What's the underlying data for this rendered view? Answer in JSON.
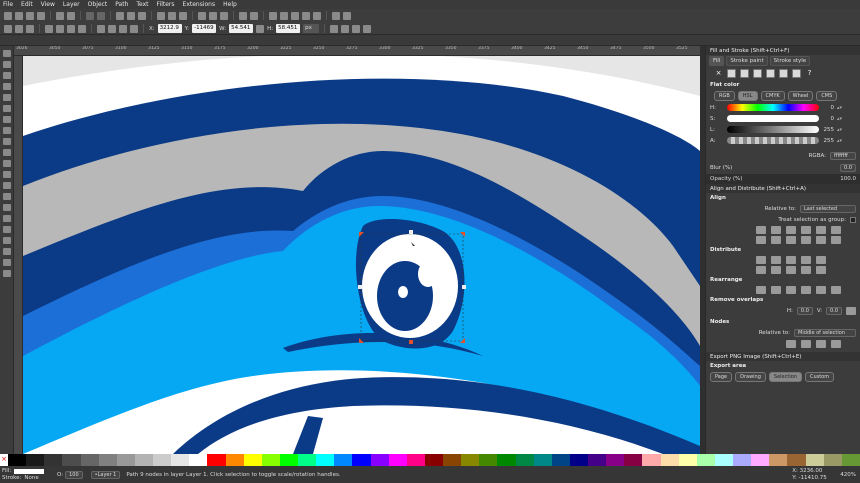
{
  "menu": [
    "File",
    "Edit",
    "View",
    "Layer",
    "Object",
    "Path",
    "Text",
    "Filters",
    "Extensions",
    "Help"
  ],
  "coords": {
    "x_label": "X:",
    "x_value": "3212.9",
    "y_label": "Y:",
    "y_value": "-11469",
    "w_label": "W:",
    "w_value": "54.541",
    "h_label": "H:",
    "h_value": "58.451",
    "unit": "px"
  },
  "ruler_labels": [
    "3026",
    "3050",
    "3075",
    "3100",
    "3125",
    "3150",
    "3175",
    "3200",
    "3225",
    "3250",
    "3275",
    "3300",
    "3325",
    "3350",
    "3375",
    "3400",
    "3425",
    "3450",
    "3475",
    "3500",
    "3525"
  ],
  "panel": {
    "fill_stroke_title": "Fill and Stroke (Shift+Ctrl+F)",
    "tabs": [
      "Fill",
      "Stroke paint",
      "Stroke style"
    ],
    "flat_color": "Flat color",
    "modes": [
      "RGB",
      "HSL",
      "CMYK",
      "Wheel",
      "CMS"
    ],
    "sliders": [
      {
        "label": "H:",
        "value": "0"
      },
      {
        "label": "S:",
        "value": "0"
      },
      {
        "label": "L:",
        "value": "255"
      },
      {
        "label": "A:",
        "value": "255"
      }
    ],
    "rgba_label": "RGBA:",
    "rgba_value": "ffffffff",
    "blur_label": "Blur (%)",
    "blur_value": "0.0",
    "opacity_label": "Opacity (%)",
    "opacity_value": "100.0",
    "align_title": "Align and Distribute (Shift+Ctrl+A)",
    "align": "Align",
    "relative_to": "Relative to:",
    "relative_value": "Last selected",
    "treat_group": "Treat selection as group:",
    "distribute": "Distribute",
    "rearrange": "Rearrange",
    "remove_overlaps": "Remove overlaps",
    "h_label": "H:",
    "h_value": "0.0",
    "v_label": "V:",
    "v_value": "0.0",
    "nodes": "Nodes",
    "nodes_relative": "Relative to:",
    "nodes_relative_value": "Middle of selection",
    "export_title": "Export PNG Image (Shift+Ctrl+E)",
    "export_area": "Export area",
    "export_buttons": [
      "Page",
      "Drawing",
      "Selection",
      "Custom"
    ]
  },
  "status": {
    "fill_label": "Fill:",
    "stroke_label": "Stroke:",
    "stroke_value": "None",
    "opacity_label": "O:",
    "opacity_value": "100",
    "layer": "•Layer 1",
    "message": "Path 9 nodes in layer Layer 1. Click selection to toggle scale/rotation handles.",
    "x_readout": "X: 3236.00",
    "y_readout": "Y: -11410.75",
    "zoom": "420%"
  },
  "colors": {
    "dark_blue": "#0b3a86",
    "mid_blue": "#1c6fd6",
    "light_blue": "#06a8f3",
    "grey_band": "#b8b8b8",
    "light_grey": "#e6e6e6"
  }
}
